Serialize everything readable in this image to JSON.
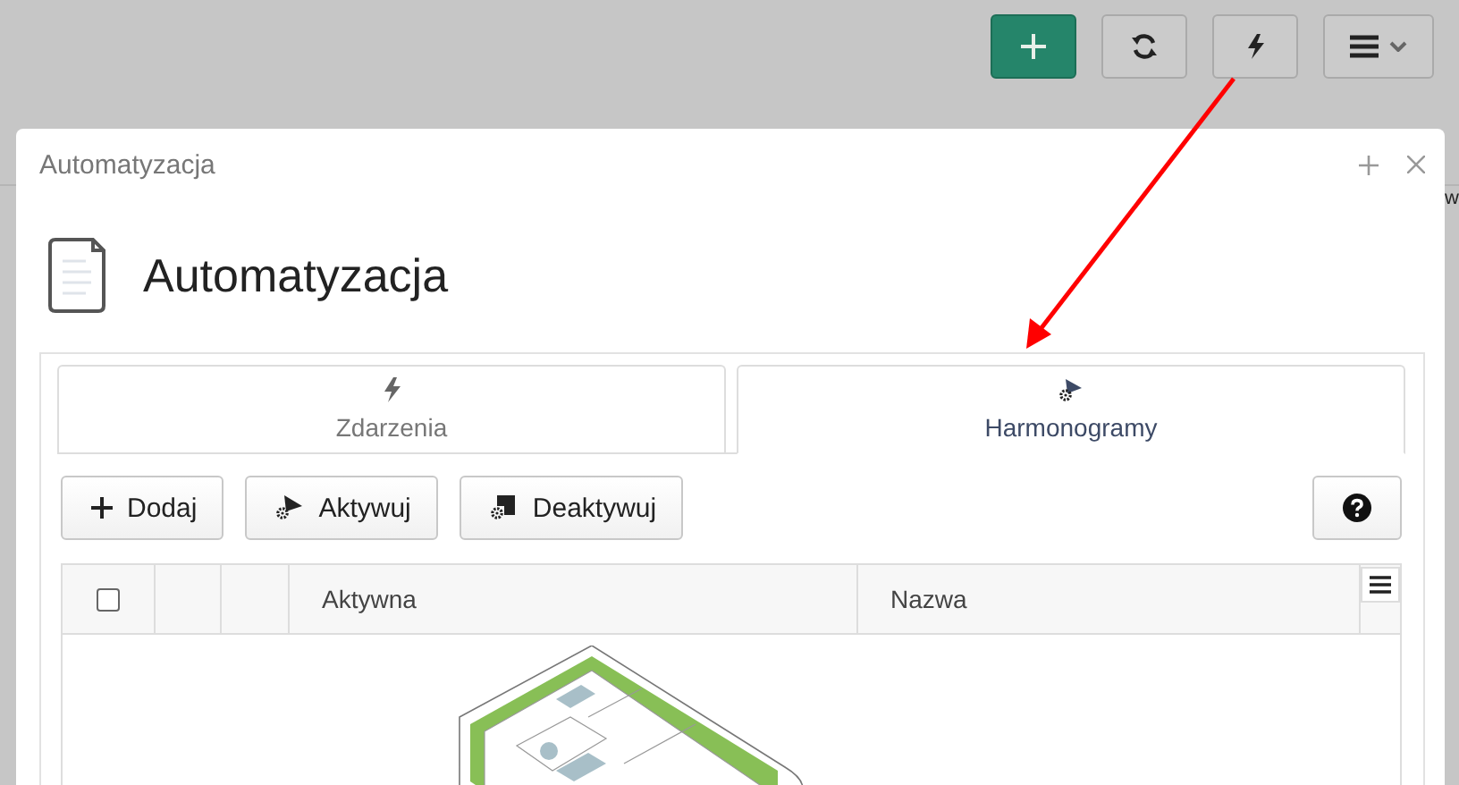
{
  "background_fragment": "w",
  "dialog": {
    "window_title": "Automatyzacja",
    "heading": "Automatyzacja",
    "tabs": [
      {
        "kind": "events",
        "label": "Zdarzenia",
        "selected": false
      },
      {
        "kind": "schedules",
        "label": "Harmonogramy",
        "selected": true
      }
    ],
    "actions": [
      {
        "kind": "add",
        "label": "Dodaj"
      },
      {
        "kind": "activate",
        "label": "Aktywuj"
      },
      {
        "kind": "deactivate",
        "label": "Deaktywuj"
      }
    ],
    "table": {
      "select_all_checked": false,
      "columns": [
        "Aktywna",
        "Nazwa"
      ]
    }
  }
}
